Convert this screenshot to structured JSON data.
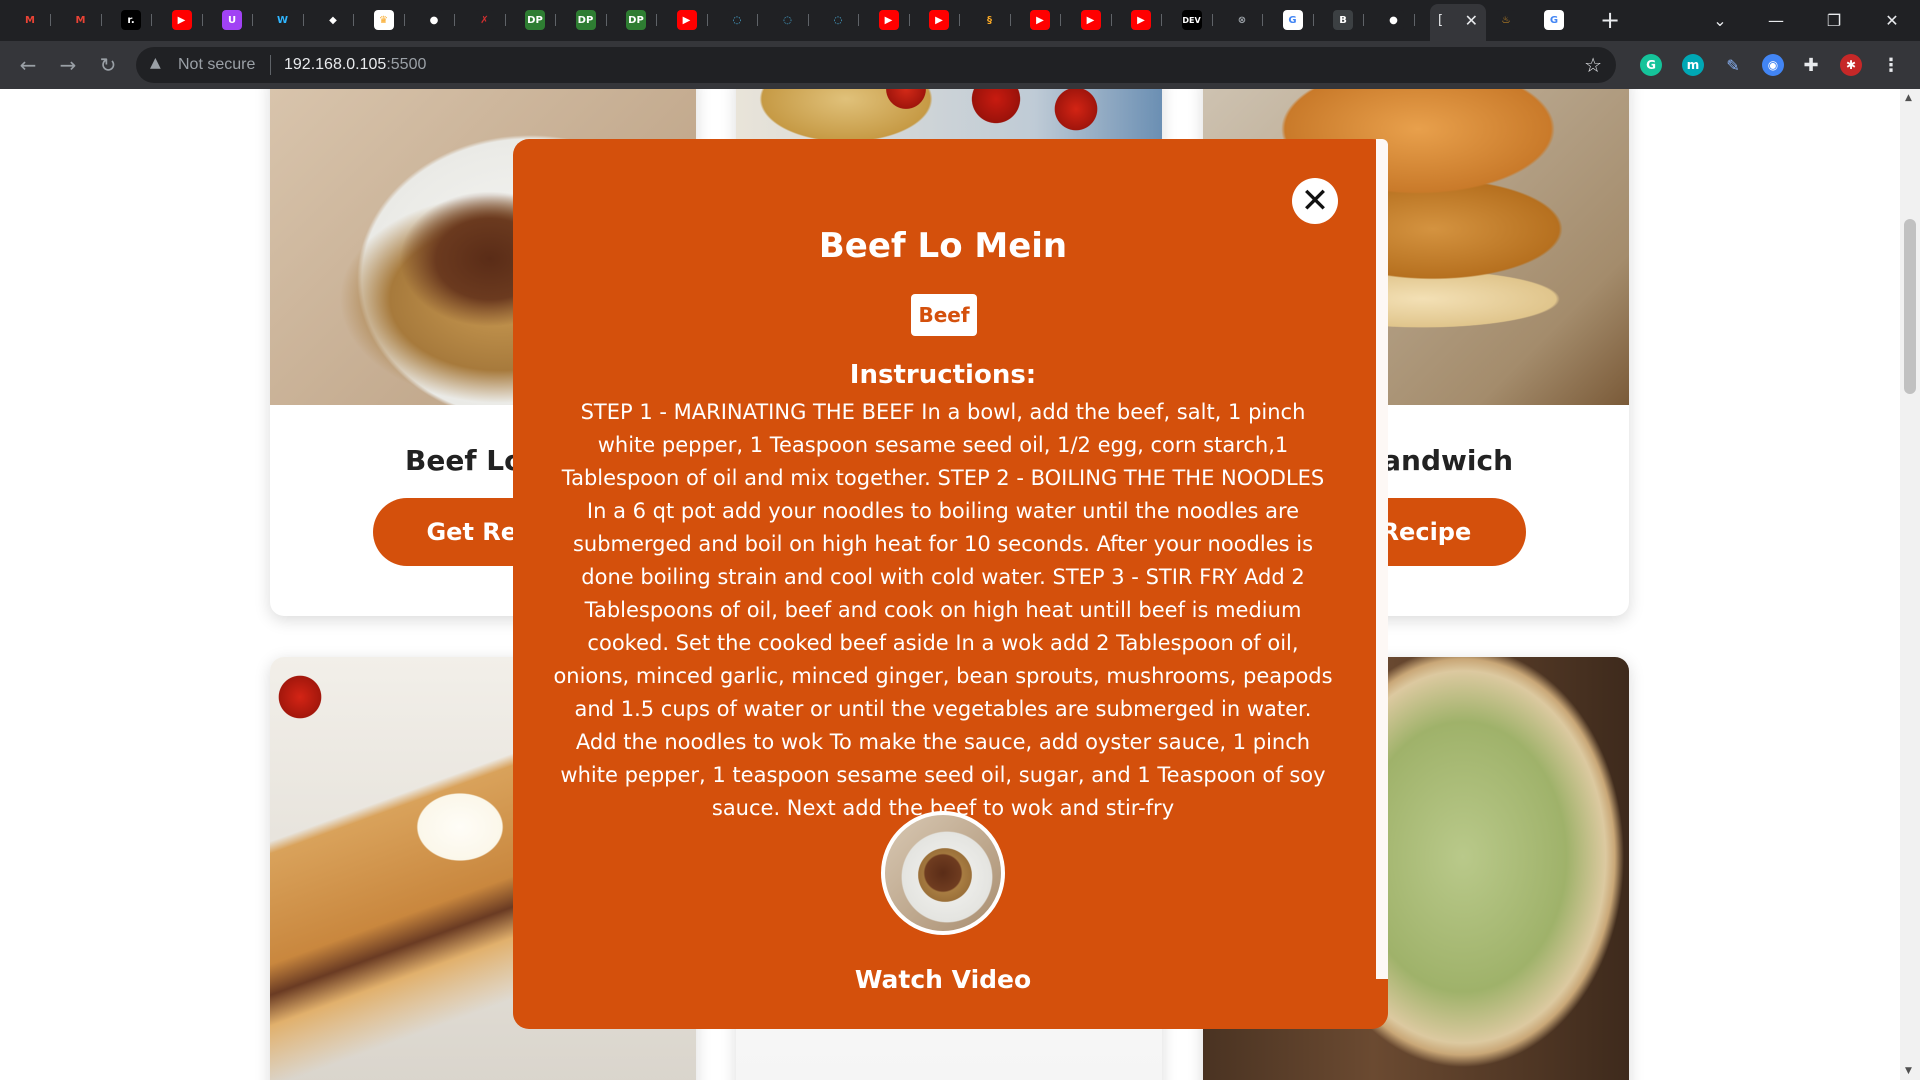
{
  "browser": {
    "tab_title": "[",
    "security_label": "Not secure",
    "url_host": "192.168.0.105",
    "url_port": ":5500",
    "new_tab_symbol": "+",
    "ext_labels": {
      "grammarly": "G",
      "m": "m"
    }
  },
  "favicons": [
    {
      "name": "gmail-icon",
      "glyph": "M",
      "bg": "#202124",
      "fg": "#ea4335"
    },
    {
      "name": "gmail-icon",
      "glyph": "M",
      "bg": "#202124",
      "fg": "#ea4335"
    },
    {
      "name": "r-icon",
      "glyph": "r.",
      "bg": "#000000",
      "fg": "#ffffff"
    },
    {
      "name": "youtube-icon",
      "glyph": "▶",
      "bg": "#ff0000",
      "fg": "#ffffff"
    },
    {
      "name": "u-icon",
      "glyph": "U",
      "bg": "#a142f4",
      "fg": "#ffffff"
    },
    {
      "name": "w-icon",
      "glyph": "W",
      "bg": "#202124",
      "fg": "#2fb5ff"
    },
    {
      "name": "chat-icon",
      "glyph": "◆",
      "bg": "#202124",
      "fg": "#ffffff"
    },
    {
      "name": "crown-icon",
      "glyph": "♛",
      "bg": "#ffffff",
      "fg": "#f9a825"
    },
    {
      "name": "github-icon",
      "glyph": "●",
      "bg": "#202124",
      "fg": "#ffffff"
    },
    {
      "name": "x-icon",
      "glyph": "✗",
      "bg": "#202124",
      "fg": "#d32f2f"
    },
    {
      "name": "dp-icon",
      "glyph": "DP",
      "bg": "#2e7d32",
      "fg": "#ffffff"
    },
    {
      "name": "dp-icon",
      "glyph": "DP",
      "bg": "#2e7d32",
      "fg": "#ffffff"
    },
    {
      "name": "dp-icon",
      "glyph": "DP",
      "bg": "#2e7d32",
      "fg": "#ffffff"
    },
    {
      "name": "youtube-icon",
      "glyph": "▶",
      "bg": "#ff0000",
      "fg": "#ffffff"
    },
    {
      "name": "loading-icon",
      "glyph": "◌",
      "bg": "#202124",
      "fg": "#4fc3f7"
    },
    {
      "name": "loading-icon",
      "glyph": "◌",
      "bg": "#202124",
      "fg": "#4fc3f7"
    },
    {
      "name": "loading-icon",
      "glyph": "◌",
      "bg": "#202124",
      "fg": "#4fc3f7"
    },
    {
      "name": "youtube-icon",
      "glyph": "▶",
      "bg": "#ff0000",
      "fg": "#ffffff"
    },
    {
      "name": "youtube-icon",
      "glyph": "▶",
      "bg": "#ff0000",
      "fg": "#ffffff"
    },
    {
      "name": "s-icon",
      "glyph": "§",
      "bg": "#202124",
      "fg": "#f9a825"
    },
    {
      "name": "youtube-icon",
      "glyph": "▶",
      "bg": "#ff0000",
      "fg": "#ffffff"
    },
    {
      "name": "youtube-icon",
      "glyph": "▶",
      "bg": "#ff0000",
      "fg": "#ffffff"
    },
    {
      "name": "youtube-icon",
      "glyph": "▶",
      "bg": "#ff0000",
      "fg": "#ffffff"
    },
    {
      "name": "dev-icon",
      "glyph": "DEV",
      "bg": "#000000",
      "fg": "#ffffff"
    },
    {
      "name": "x-circle-icon",
      "glyph": "⊗",
      "bg": "#202124",
      "fg": "#9aa0a6"
    },
    {
      "name": "google-icon",
      "glyph": "G",
      "bg": "#ffffff",
      "fg": "#4285f4"
    },
    {
      "name": "b-icon",
      "glyph": "B",
      "bg": "#3c4043",
      "fg": "#ffffff"
    },
    {
      "name": "github-icon",
      "glyph": "●",
      "bg": "#202124",
      "fg": "#ffffff"
    }
  ],
  "cards": [
    {
      "title": "Beef Lo M",
      "button": "Get Reci"
    },
    {
      "title": "-A Sandwich",
      "button": "t Recipe"
    }
  ],
  "modal": {
    "title": "Beef Lo Mein",
    "category": "Beef",
    "instructions_heading": "Instructions:",
    "instructions": "STEP 1 - MARINATING THE BEEF In a bowl, add the beef, salt, 1 pinch white pepper, 1 Teaspoon sesame seed oil, 1/2 egg, corn starch,1 Tablespoon of oil and mix together. STEP 2 - BOILING THE THE NOODLES In a 6 qt pot add your noodles to boiling water until the noodles are submerged and boil on high heat for 10 seconds. After your noodles is done boiling strain and cool with cold water. STEP 3 - STIR FRY Add 2 Tablespoons of oil, beef and cook on high heat untill beef is medium cooked. Set the cooked beef aside In a wok add 2 Tablespoon of oil, onions, minced garlic, minced ginger, bean sprouts, mushrooms, peapods and 1.5 cups of water or until the vegetables are submerged in water. Add the noodles to wok To make the sauce, add oyster sauce, 1 pinch white pepper, 1 teaspoon sesame seed oil, sugar, and 1 Teaspoon of soy sauce. Next add the beef to wok and stir-fry",
    "video_label": "Watch Video",
    "close_symbol": "✕"
  },
  "colors": {
    "accent": "#d4500c",
    "chrome_dark": "#202124",
    "chrome_mid": "#35363a"
  }
}
